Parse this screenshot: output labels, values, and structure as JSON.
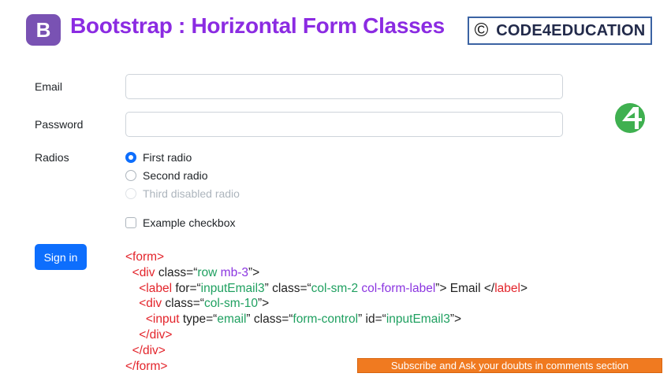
{
  "header": {
    "logo_letter": "B",
    "title": "Bootstrap : Horizontal Form Classes",
    "brand_copyright": "©",
    "brand_name": "CODE4EDUCATION"
  },
  "form": {
    "email_label": "Email",
    "password_label": "Password",
    "radios_label": "Radios",
    "radios": [
      {
        "label": "First radio",
        "checked": true,
        "disabled": false
      },
      {
        "label": "Second radio",
        "checked": false,
        "disabled": false
      },
      {
        "label": "Third disabled radio",
        "checked": false,
        "disabled": true
      }
    ],
    "checkbox_label": "Example checkbox",
    "submit_label": "Sign in"
  },
  "code": {
    "l1_open": "<form>",
    "l2_lt": "<",
    "l2_tag": "div",
    "l2_attr": " class=“",
    "l2_val1": "row ",
    "l2_val2": "mb-3",
    "l2_end": "”>",
    "l3_lt": "<",
    "l3_tag": "label",
    "l3_attr1": " for=“",
    "l3_val1": "inputEmail3",
    "l3_attr2": "” class=“",
    "l3_val2": "col-sm-2 ",
    "l3_val3": "col-form-label",
    "l3_mid": "”> Email </",
    "l3_tag2": "label",
    "l3_end": ">",
    "l4_lt": "<",
    "l4_tag": "div",
    "l4_attr": " class=“",
    "l4_val": "col-sm-10",
    "l4_end": "”>",
    "l5_lt": "<",
    "l5_tag": "input",
    "l5_attr1": " type=“",
    "l5_val1": "email",
    "l5_attr2": "” class=“",
    "l5_val2": "form-control",
    "l5_attr3": "” id=“",
    "l5_val3": "inputEmail3",
    "l5_end": "”>",
    "l6_close": "</div>",
    "l7_close": "</div>",
    "l8_close": "</form>"
  },
  "banner": {
    "text": "Subscribe and Ask your doubts in comments section"
  },
  "colors": {
    "title": "#8b2be2",
    "bootstrap_logo": "#7952b3",
    "primary": "#0d6efd",
    "code_tag": "#e3242b",
    "code_string": "#1fa060",
    "banner": "#f07a20"
  }
}
